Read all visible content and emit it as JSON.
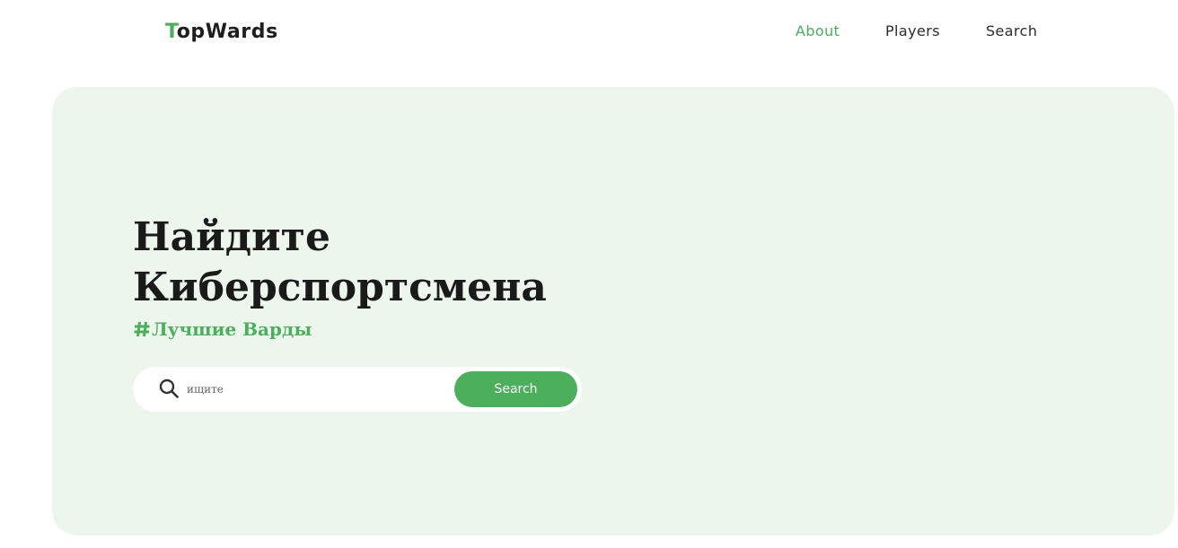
{
  "header": {
    "logo_initial": "T",
    "logo_rest": "opWards",
    "nav": [
      {
        "label": "About",
        "active": true
      },
      {
        "label": "Players",
        "active": false
      },
      {
        "label": "Search",
        "active": false
      }
    ]
  },
  "hero": {
    "title_line1": "Найдите",
    "title_line2": "Киберспортсмена",
    "tagline": "Лучшие Варды",
    "search": {
      "placeholder": "ищите",
      "value": "",
      "button_label": "Search"
    }
  },
  "colors": {
    "accent": "#4caf5c",
    "hero_background": "#edf6ed",
    "text": "#1a1a1a"
  },
  "icons": {
    "tagline_icon": "hashtag-icon",
    "search_icon": "magnifier-icon"
  }
}
